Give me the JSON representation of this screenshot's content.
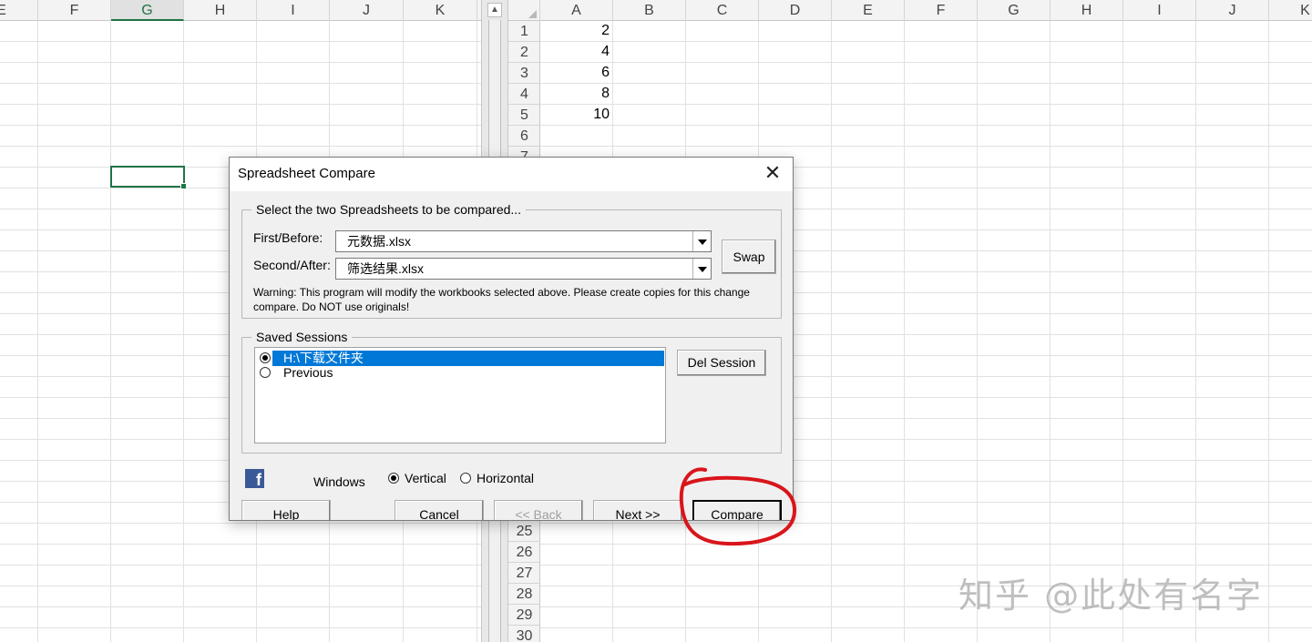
{
  "left_sheet": {
    "columns": [
      "E",
      "F",
      "G",
      "H",
      "I",
      "J",
      "K"
    ],
    "selected_column": "G"
  },
  "right_sheet": {
    "columns": [
      "A",
      "B",
      "C",
      "D",
      "E",
      "F",
      "G",
      "H",
      "I",
      "J",
      "K"
    ],
    "rows_top": [
      "1",
      "2",
      "3",
      "4",
      "5",
      "6",
      "7"
    ],
    "rows_bottom": [
      "25",
      "26",
      "27",
      "28",
      "29",
      "30"
    ],
    "column_a_values": [
      "2",
      "4",
      "6",
      "8",
      "10"
    ]
  },
  "scrollbar": {
    "up_arrow": "▲"
  },
  "dialog": {
    "title": "Spreadsheet Compare",
    "close_glyph": "✕",
    "select_group": {
      "legend": "Select the two Spreadsheets to be compared...",
      "first_label": "First/Before:",
      "first_value": "元数据.xlsx",
      "second_label": "Second/After:",
      "second_value": "筛选结果.xlsx",
      "swap_label": "Swap",
      "warning": "Warning: This program will modify the workbooks selected above. Please create copies for this change compare. Do NOT use originals!"
    },
    "sessions_group": {
      "legend": "Saved Sessions",
      "items": [
        {
          "label": "H:\\下载文件夹",
          "selected": true
        },
        {
          "label": "Previous",
          "selected": false
        }
      ],
      "del_label": "Del Session"
    },
    "facebook_icon": "f",
    "windows": {
      "label": "Windows",
      "options": [
        {
          "label": "Vertical",
          "checked": true
        },
        {
          "label": "Horizontal",
          "checked": false
        }
      ]
    },
    "buttons": {
      "help": "Help",
      "cancel": "Cancel",
      "back": "<< Back",
      "next": "Next >>",
      "compare": "Compare"
    }
  },
  "annotation": {
    "color": "#d9151b"
  },
  "watermark": "知乎 @此处有名字"
}
